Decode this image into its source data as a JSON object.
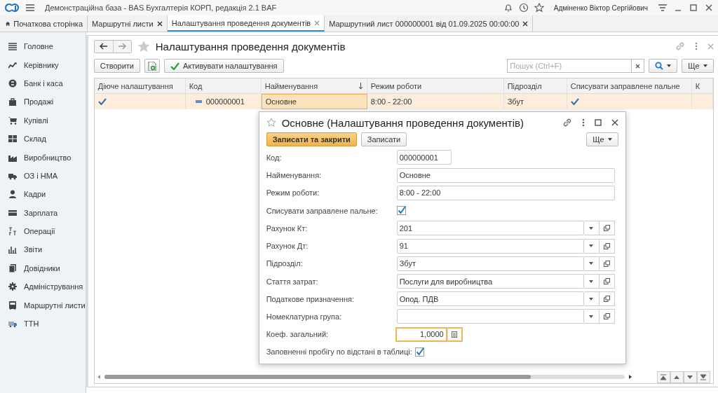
{
  "app": {
    "title": "Демонстраційна база - BAS Бухгалтерія КОРП, редакція 2.1 BAF",
    "user": "Адміненко Віктор Сергійович"
  },
  "tabs": [
    {
      "kind": "home",
      "label": "Початкова сторінка",
      "selected": false
    },
    {
      "kind": "doc",
      "label": "Маршрутні листи",
      "selected": false
    },
    {
      "kind": "doc",
      "label": "Налаштування проведення документів",
      "selected": true
    },
    {
      "kind": "doc",
      "label": "Маршрутний лист 000000001 від 01.09.2025 00:00:00",
      "selected": false
    }
  ],
  "sidebar": {
    "items": [
      {
        "label": "Головне"
      },
      {
        "label": "Керівнику"
      },
      {
        "label": "Банк і каса"
      },
      {
        "label": "Продажі"
      },
      {
        "label": "Купівлі"
      },
      {
        "label": "Склад"
      },
      {
        "label": "Виробництво"
      },
      {
        "label": "ОЗ і НМА"
      },
      {
        "label": "Кадри"
      },
      {
        "label": "Зарплата"
      },
      {
        "label": "Операції"
      },
      {
        "label": "Звіти"
      },
      {
        "label": "Довідники"
      },
      {
        "label": "Адміністрування"
      },
      {
        "label": "Маршрутні листи"
      },
      {
        "label": "ТТН"
      }
    ]
  },
  "page": {
    "title": "Налаштування проведення документів",
    "create_button": "Створити",
    "activate_button": "Активувати налаштування",
    "search": {
      "placeholder": "Пошук (Ctrl+F)"
    },
    "more_button": "Ще"
  },
  "table": {
    "columns": [
      {
        "label": "Діюче налаштування",
        "sorted": false
      },
      {
        "label": "Код",
        "sorted": false
      },
      {
        "label": "Найменування",
        "sorted": true
      },
      {
        "label": "Режим роботи",
        "sorted": false
      },
      {
        "label": "Підрозділ",
        "sorted": false
      },
      {
        "label": "Списувати заправлене пальне",
        "sorted": false
      },
      {
        "label": "К",
        "sorted": false
      }
    ],
    "rows": [
      {
        "selected": true,
        "cells": [
          {
            "kind": "check",
            "checked": true,
            "current": false
          },
          {
            "kind": "code",
            "text": "000000001",
            "current": false
          },
          {
            "kind": "text",
            "text": "Основне",
            "current": true
          },
          {
            "kind": "text",
            "text": "8:00 - 22:00",
            "current": false
          },
          {
            "kind": "text",
            "text": "Збут",
            "current": false
          },
          {
            "kind": "check",
            "checked": true,
            "current": false
          },
          {
            "kind": "empty",
            "current": false
          }
        ]
      }
    ]
  },
  "dialog": {
    "title": "Основне (Налаштування проведення документів)",
    "save_close_button": "Записати та закрити",
    "save_button": "Записати",
    "more_button": "Ще",
    "fields": [
      {
        "kind": "short",
        "label": "Код:",
        "value": "000000001",
        "focused": false
      },
      {
        "kind": "text",
        "label": "Найменування:",
        "value": "Основне",
        "focused": false
      },
      {
        "kind": "text",
        "label": "Режим роботи:",
        "value": "8:00 - 22:00",
        "focused": false
      },
      {
        "kind": "checkbox",
        "label": "Списувати заправлене пальне:",
        "checked": true
      },
      {
        "kind": "select",
        "label": "Рахунок Кт:",
        "value": "201",
        "focused": false
      },
      {
        "kind": "select",
        "label": "Рахунок Дт:",
        "value": "91",
        "focused": false
      },
      {
        "kind": "select",
        "label": "Підрозділ:",
        "value": "Збут",
        "focused": false
      },
      {
        "kind": "select",
        "label": "Стаття затрат:",
        "value": "Послуги для виробництва",
        "focused": false
      },
      {
        "kind": "select",
        "label": "Податкове призначення:",
        "value": "Опод. ПДВ",
        "focused": false
      },
      {
        "kind": "select",
        "label": "Номеклатурна група:",
        "focused": false
      },
      {
        "kind": "number",
        "label": "Коеф. загальний:",
        "value": "1,0000",
        "focused": true
      },
      {
        "kind": "checkbox",
        "label": "Заповненні пробігу по відстані в таблиці:",
        "checked": true
      }
    ]
  }
}
